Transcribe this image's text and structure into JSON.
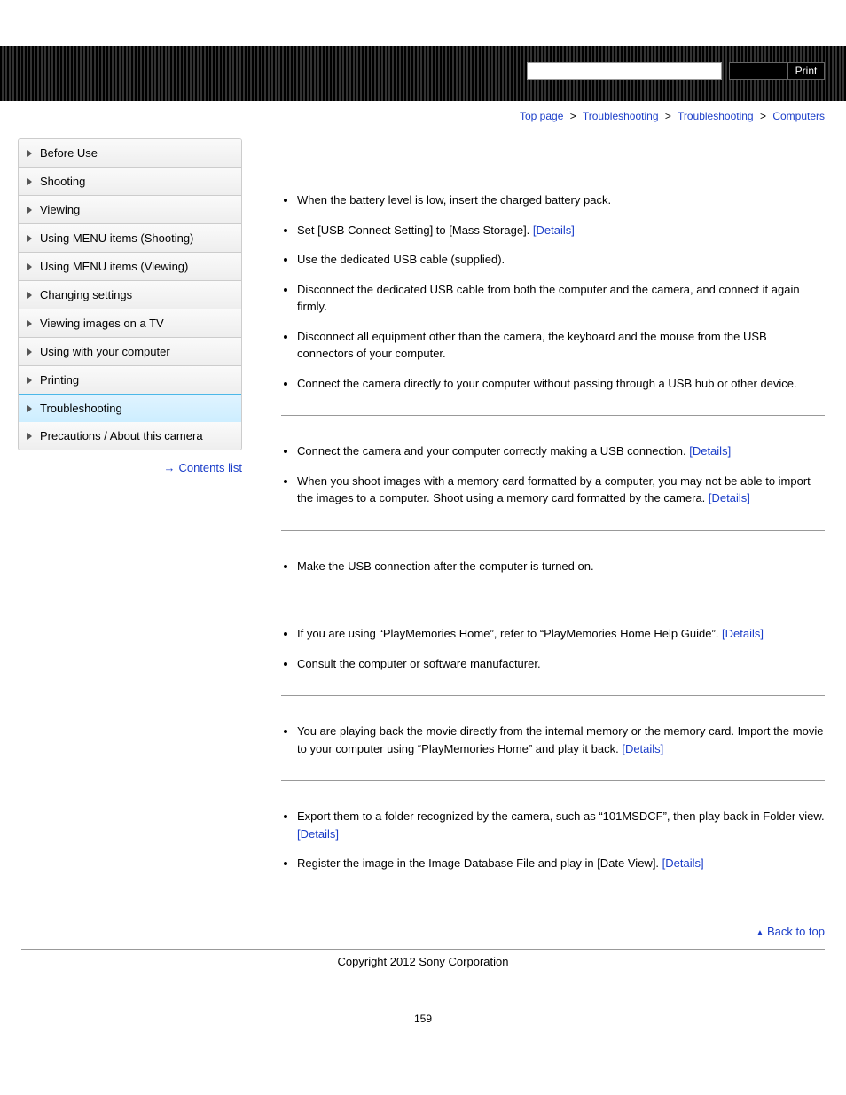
{
  "header": {
    "print_label": "Print"
  },
  "breadcrumb": {
    "items": [
      "Top page",
      "Troubleshooting",
      "Troubleshooting",
      "Computers"
    ],
    "sep": ">"
  },
  "sidebar": {
    "items": [
      "Before Use",
      "Shooting",
      "Viewing",
      "Using MENU items (Shooting)",
      "Using MENU items (Viewing)",
      "Changing settings",
      "Viewing images on a TV",
      "Using with your computer",
      "Printing",
      "Troubleshooting",
      "Precautions / About this camera"
    ],
    "active_index": 9,
    "contents_list": "Contents list"
  },
  "sections": [
    {
      "items": [
        {
          "text": "When the battery level is low, insert the charged battery pack."
        },
        {
          "text": "Set [USB Connect Setting] to [Mass Storage]. ",
          "link": "[Details]"
        },
        {
          "text": "Use the dedicated USB cable (supplied)."
        },
        {
          "text": "Disconnect the dedicated USB cable from both the computer and the camera, and connect it again firmly."
        },
        {
          "text": "Disconnect all equipment other than the camera, the keyboard and the mouse from the USB connectors of your computer."
        },
        {
          "text": "Connect the camera directly to your computer without passing through a USB hub or other device."
        }
      ]
    },
    {
      "items": [
        {
          "text": "Connect the camera and your computer correctly making a USB connection. ",
          "link": "[Details]"
        },
        {
          "text": "When you shoot images with a memory card formatted by a computer, you may not be able to import the images to a computer. Shoot using a memory card formatted by the camera. ",
          "link": "[Details]"
        }
      ]
    },
    {
      "items": [
        {
          "text": "Make the USB connection after the computer is turned on."
        }
      ]
    },
    {
      "items": [
        {
          "text": "If you are using “PlayMemories Home”, refer to “PlayMemories Home Help Guide”. ",
          "link": "[Details]"
        },
        {
          "text": "Consult the computer or software manufacturer."
        }
      ]
    },
    {
      "items": [
        {
          "text": "You are playing back the movie directly from the internal memory or the memory card. Import the movie to your computer using “PlayMemories Home” and play it back. ",
          "link": "[Details]"
        }
      ]
    },
    {
      "items": [
        {
          "text": "Export them to a folder recognized by the camera, such as “101MSDCF”, then play back in Folder view. ",
          "link": "[Details]"
        },
        {
          "text": "Register the image in the Image Database File and play in [Date View]. ",
          "link": "[Details]"
        }
      ]
    }
  ],
  "back_to_top": "Back to top",
  "copyright": "Copyright 2012 Sony Corporation",
  "page_number": "159"
}
